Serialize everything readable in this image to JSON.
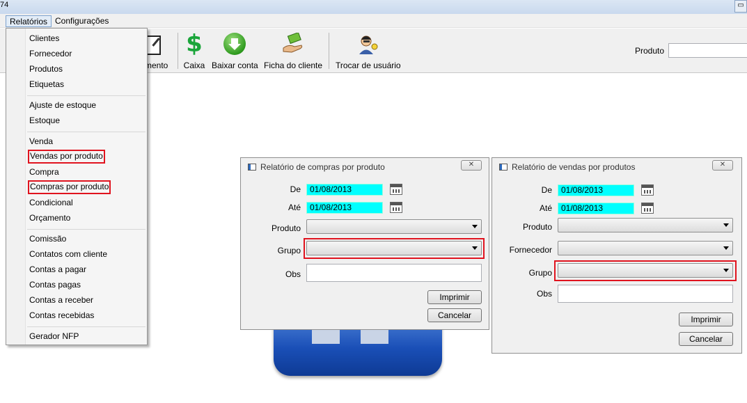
{
  "window": {
    "title_fragment": "74",
    "restore_glyph": "▭"
  },
  "menubar": {
    "items": [
      "Relatórios",
      "Configurações"
    ]
  },
  "toolbar": {
    "partial_label": "mento",
    "buttons": [
      {
        "label": "Caixa",
        "icon": "dollar-icon"
      },
      {
        "label": "Baixar conta",
        "icon": "download-arrow-icon"
      },
      {
        "label": "Ficha do cliente",
        "icon": "hand-money-icon"
      },
      {
        "label": "Trocar de usuário",
        "icon": "user-key-icon"
      }
    ],
    "product_label": "Produto",
    "product_value": ""
  },
  "relatorios_menu": {
    "groups": [
      [
        "Clientes",
        "Fornecedor",
        "Produtos",
        "Etiquetas"
      ],
      [
        "Ajuste de estoque",
        "Estoque"
      ],
      [
        "Venda",
        "Vendas por produto",
        "Compra",
        "Compras por produto",
        "Condicional",
        "Orçamento"
      ],
      [
        "Comissão",
        "Contatos com cliente",
        "Contas a pagar",
        "Contas pagas",
        "Contas a receber",
        "Contas recebidas"
      ],
      [
        "Gerador NFP"
      ]
    ],
    "highlighted": [
      "Vendas por produto",
      "Compras por produto"
    ],
    "highlight_color": "#e0131e"
  },
  "dialog_compras": {
    "title": "Relatório de compras por produto",
    "close_glyph": "✕",
    "de_label": "De",
    "de_value": "01/08/2013",
    "ate_label": "Até",
    "ate_value": "01/08/2013",
    "produto_label": "Produto",
    "produto_value": "",
    "grupo_label": "Grupo",
    "grupo_value": "",
    "obs_label": "Obs",
    "obs_value": "",
    "print_button": "Imprimir",
    "cancel_button": "Cancelar"
  },
  "dialog_vendas": {
    "title": "Relatório de vendas por produtos",
    "close_glyph": "✕",
    "de_label": "De",
    "de_value": "01/08/2013",
    "ate_label": "Até",
    "ate_value": "01/08/2013",
    "produto_label": "Produto",
    "produto_value": "",
    "fornecedor_label": "Fornecedor",
    "fornecedor_value": "",
    "grupo_label": "Grupo",
    "grupo_value": "",
    "obs_label": "Obs",
    "obs_value": "",
    "print_button": "Imprimir",
    "cancel_button": "Cancelar"
  },
  "colors": {
    "date_field": "#00ffff",
    "highlight": "#e0131e",
    "toolbar_bg": "#f0f0f0"
  }
}
